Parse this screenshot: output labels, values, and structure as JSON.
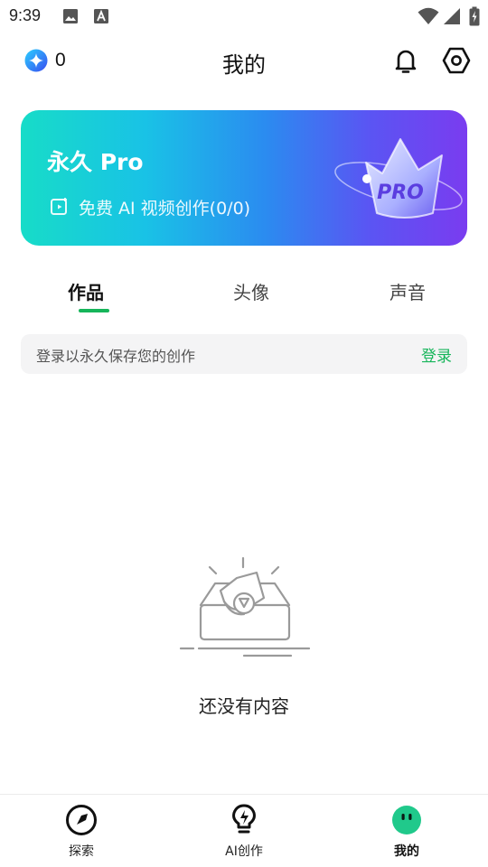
{
  "status_bar": {
    "time": "9:39",
    "icons": [
      "image-icon",
      "text-a-icon",
      "wifi-icon",
      "signal-icon",
      "battery-icon"
    ]
  },
  "header": {
    "gem_count": "0",
    "title": "我的",
    "icons": [
      "gem-icon",
      "bell-icon",
      "settings-icon"
    ]
  },
  "pro_card": {
    "title": "永久 Pro",
    "subtitle": "免费 AI 视频创作(0/0)",
    "badge": "PRO",
    "gradient": [
      "#17dcc8",
      "#19c2e6",
      "#2b8bf0",
      "#5a55f3",
      "#7a3cf0"
    ]
  },
  "tabs": [
    {
      "label": "作品",
      "active": true
    },
    {
      "label": "头像",
      "active": false
    },
    {
      "label": "声音",
      "active": false
    }
  ],
  "login_bar": {
    "text": "登录以永久保存您的创作",
    "button": "登录"
  },
  "empty_state": {
    "text": "还没有内容",
    "icon": "empty-box-icon"
  },
  "bottom_nav": [
    {
      "label": "探索",
      "icon": "compass-icon",
      "active": false
    },
    {
      "label": "AI创作",
      "icon": "lightbulb-icon",
      "active": false
    },
    {
      "label": "我的",
      "icon": "profile-face-icon",
      "active": true
    }
  ],
  "colors": {
    "accent": "#16b55a",
    "text": "#1f1f1f",
    "muted": "#555555",
    "login_bg": "#f4f4f5"
  }
}
